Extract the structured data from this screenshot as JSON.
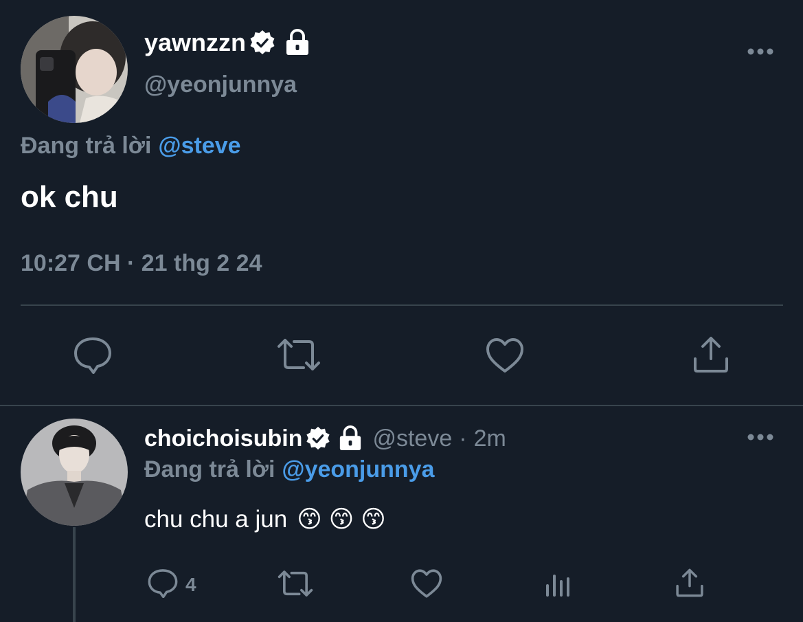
{
  "main_tweet": {
    "display_name": "yawnzzn",
    "handle": "@yeonjunnya",
    "replying_label": "Đang trả lời",
    "replying_to": "@steve",
    "text": "ok chu",
    "timestamp": "10:27 CH · 21 thg 2 24",
    "icons": [
      "verified-icon",
      "lock-icon",
      "more-icon",
      "reply-icon",
      "retweet-icon",
      "like-icon",
      "share-icon"
    ]
  },
  "reply_tweet": {
    "display_name": "choichoisubin",
    "handle": "@steve",
    "separator": "·",
    "time_ago": "2m",
    "replying_label": "Đang trả lời",
    "replying_to": "@yeonjunnya",
    "text": "chu chu a jun",
    "emojis": [
      "😙",
      "😙",
      "😙"
    ],
    "reply_count": "4",
    "icons": [
      "verified-icon",
      "lock-icon",
      "more-icon",
      "reply-icon",
      "retweet-icon",
      "like-icon",
      "analytics-icon",
      "share-icon"
    ]
  },
  "colors": {
    "background": "#151d28",
    "muted": "#7c8996",
    "link": "#4a9ce8",
    "divider": "#38444d"
  }
}
